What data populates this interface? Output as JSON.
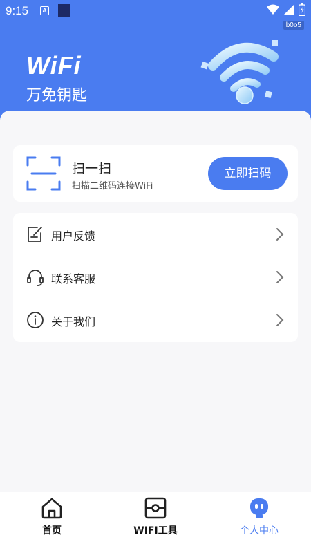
{
  "status_bar": {
    "time": "9:15",
    "notification_letter": "A",
    "icons": [
      "wifi-icon",
      "signal-icon",
      "battery-icon"
    ]
  },
  "debug_tag": "b0o5",
  "header": {
    "logo_text": "WiFi",
    "brand_name": "万免钥匙",
    "accent_color": "#4a7cf0"
  },
  "scan_card": {
    "title": "扫一扫",
    "subtitle": "扫描二维码连接WiFi",
    "button_label": "立即扫码",
    "icon": "scan-frame-icon"
  },
  "menu": {
    "items": [
      {
        "label": "用户反馈",
        "icon": "feedback-icon"
      },
      {
        "label": "联系客服",
        "icon": "headset-icon"
      },
      {
        "label": "关于我们",
        "icon": "info-icon"
      }
    ]
  },
  "tabbar": {
    "tabs": [
      {
        "label": "首页",
        "icon": "home-icon",
        "active": false
      },
      {
        "label": "WIFI工具",
        "icon": "router-tool-icon",
        "active": false
      },
      {
        "label": "个人中心",
        "icon": "profile-robot-icon",
        "active": true
      }
    ]
  }
}
